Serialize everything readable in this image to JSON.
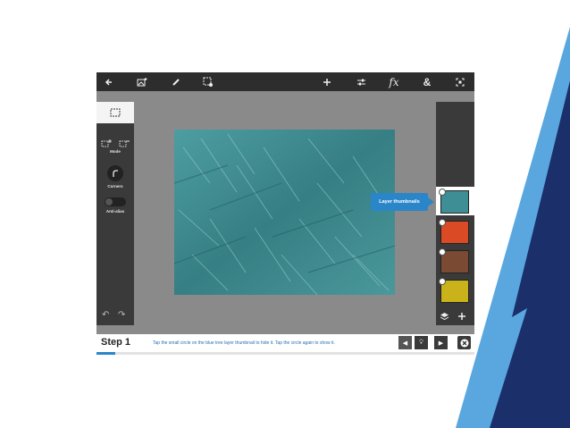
{
  "toolbar": {
    "icons": [
      "back-arrow-icon",
      "image-add-icon",
      "brush-icon",
      "selection-settings-icon",
      "plus-icon",
      "adjustments-icon",
      "fx-icon",
      "ampersand-icon",
      "fit-screen-icon"
    ],
    "fx_label": "fx",
    "amp_label": "&"
  },
  "tools": {
    "mode_label": "Mode",
    "corners_label": "Corners",
    "antialias_label": "Anti-alias"
  },
  "layers": {
    "tooltip": "Layer thumbnails",
    "thumb_colors": [
      "#3d8f95",
      "#d94a25",
      "#7a4a33",
      "#c9b21a"
    ]
  },
  "step": {
    "title": "Step 1",
    "instruction": "Tap the small circle on the blue tree layer thumbnail to hide it. Tap the circle again to show it.",
    "progress": 0.05
  },
  "colors": {
    "accent": "#2a86c9",
    "stripe_light": "#5aa7e0",
    "stripe_dark": "#1b2f6b"
  }
}
